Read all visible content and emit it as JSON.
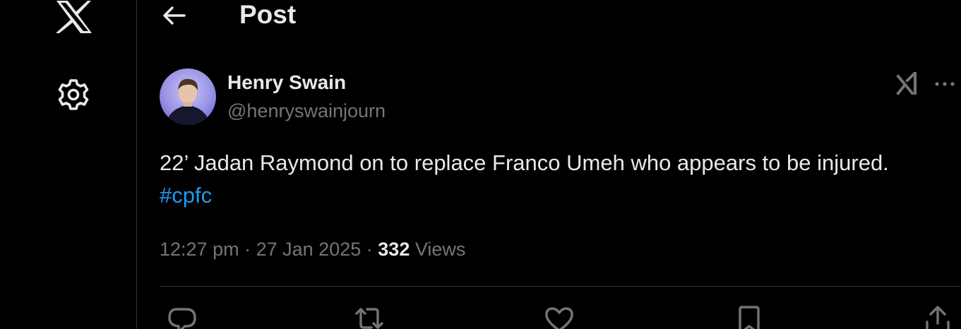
{
  "header": {
    "title": "Post"
  },
  "nav": {
    "logo_icon": "x-logo-icon",
    "settings_icon": "gear-icon",
    "back_icon": "arrow-left-icon"
  },
  "post": {
    "author": {
      "name": "Henry Swain",
      "handle": "@henryswainjourn"
    },
    "text_main": "22’ Jadan Raymond on to replace Franco Umeh who appears to be injured.",
    "hashtag": "#cpfc",
    "time": "12:27 pm",
    "date": "27 Jan 2025",
    "separator": "·",
    "views_count": "332",
    "views_label": "Views"
  },
  "actions": [
    {
      "name": "reply",
      "icon": "reply-icon"
    },
    {
      "name": "repost",
      "icon": "repost-icon"
    },
    {
      "name": "like",
      "icon": "heart-icon"
    },
    {
      "name": "bookmark",
      "icon": "bookmark-icon"
    },
    {
      "name": "share",
      "icon": "share-icon"
    }
  ],
  "colors": {
    "background": "#000000",
    "text_primary": "#e7e9ea",
    "text_secondary": "#71767b",
    "accent": "#1d9bf0",
    "border": "#2f3336"
  }
}
